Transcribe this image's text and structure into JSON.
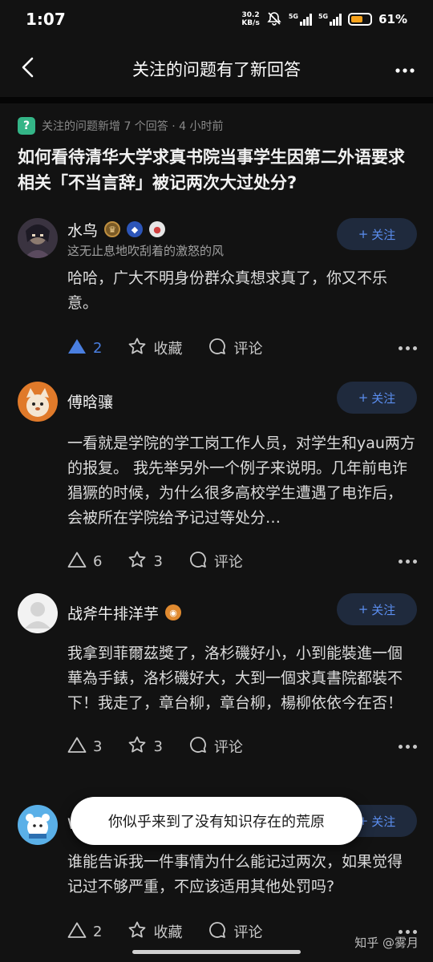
{
  "status_bar": {
    "time": "1:07",
    "net_speed_value": "30.2",
    "net_speed_unit": "KB/s",
    "signal1_label": "5G",
    "signal2_label": "5G",
    "battery_percent": "61%",
    "battery_level": 0.61,
    "battery_color": "#f7a21b"
  },
  "nav": {
    "title": "关注的问题有了新回答",
    "back_icon": "chevron-left-icon",
    "more_icon": "more-horizontal-icon"
  },
  "question": {
    "meta": "关注的问题新增 7 个回答 · 4 小时前",
    "title": "如何看待清华大学求真书院当事学生因第二外语要求相关「不当言辞」被记两次大过处分?"
  },
  "answers": [
    {
      "name": "水鸟",
      "subtitle": "这无止息地吹刮着的激怒的风",
      "follow_label": "关注",
      "body": "哈哈，广大不明身份群众真想求真了，你又不乐意。",
      "vote_count": "2",
      "vote_active": true,
      "second_action": "收藏",
      "comment_label": "评论"
    },
    {
      "name": "傅晗骧",
      "subtitle": "",
      "follow_label": "关注",
      "body": "一看就是学院的学工岗工作人员，对学生和yau两方的报复。 我先举另外一个例子来说明。几年前电诈猖獗的时候，为什么很多高校学生遭遇了电诈后，会被所在学院给予记过等处分…",
      "vote_count": "6",
      "vote_active": false,
      "second_action": "3",
      "comment_label": "评论"
    },
    {
      "name": "战斧牛排洋芋",
      "subtitle": "",
      "follow_label": "关注",
      "body": "我拿到菲爾茲獎了，洛杉磯好小，小到能裝進一個華為手錶，洛杉磯好大，大到一個求真書院都裝不下！我走了，章台柳，章台柳，楊柳依依今在否！",
      "vote_count": "3",
      "vote_active": false,
      "second_action": "3",
      "comment_label": "评论"
    },
    {
      "name": "W",
      "subtitle": "",
      "follow_label": "关注",
      "body": "谁能告诉我一件事情为什么能记过两次，如果觉得记过不够严重，不应该适用其他处罚吗?",
      "vote_count": "2",
      "vote_active": false,
      "second_action": "收藏",
      "comment_label": "评论"
    }
  ],
  "toast": "你似乎来到了没有知识存在的荒原",
  "watermark": "知乎 @雾月",
  "colors": {
    "background": "#121212",
    "accent": "#4a7fe0",
    "follow_bg": "#1f2a3d"
  }
}
